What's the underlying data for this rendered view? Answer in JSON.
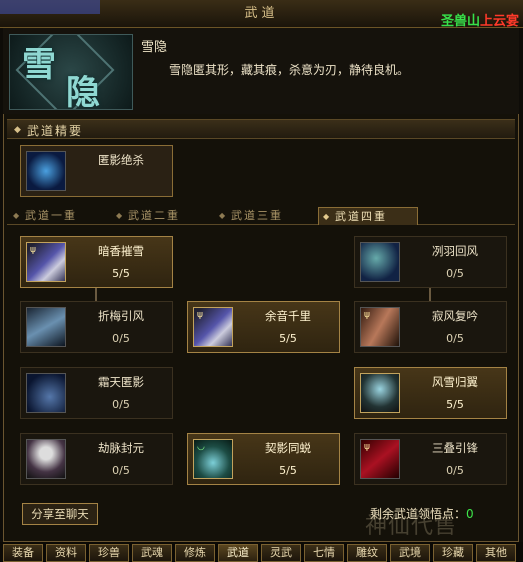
{
  "window": {
    "title": "武道",
    "scene_prefix": "圣兽山",
    "scene_suffix": "上云宴"
  },
  "skill": {
    "name": "雪隐",
    "icon_chars": [
      "雪",
      "隐"
    ],
    "description": "雪隐匿其形，藏其痕，杀意为刃，静待良机。"
  },
  "essentials": {
    "title": "武道精要",
    "feature_name": "匿影绝杀"
  },
  "tabs": [
    "武道一重",
    "武道二重",
    "武道三重",
    "武道四重"
  ],
  "active_tab": 3,
  "nodes": [
    {
      "name": "暗香摧雪",
      "points": "5/5",
      "active": true
    },
    {
      "name": "冽羽回风",
      "points": "0/5",
      "active": false
    },
    {
      "name": "折梅引风",
      "points": "0/5",
      "active": false
    },
    {
      "name": "余音千里",
      "points": "5/5",
      "active": true
    },
    {
      "name": "寂风复吟",
      "points": "0/5",
      "active": false
    },
    {
      "name": "霜天匿影",
      "points": "0/5",
      "active": false
    },
    {
      "name": "风雪归翼",
      "points": "5/5",
      "active": true
    },
    {
      "name": "劫脉封元",
      "points": "0/5",
      "active": false
    },
    {
      "name": "契影同蜕",
      "points": "5/5",
      "active": true
    },
    {
      "name": "三叠引锋",
      "points": "0/5",
      "active": false
    }
  ],
  "footer": {
    "share_label": "分享至聊天",
    "remaining_label": "剩余武道领悟点：",
    "remaining_value": "0",
    "watermark": "神仙代售"
  },
  "bottom_tabs": [
    "装备",
    "资料",
    "珍兽",
    "武魂",
    "修炼",
    "武道",
    "灵武",
    "七情",
    "雕纹",
    "武境",
    "珍藏",
    "其他"
  ],
  "bottom_active": 5
}
